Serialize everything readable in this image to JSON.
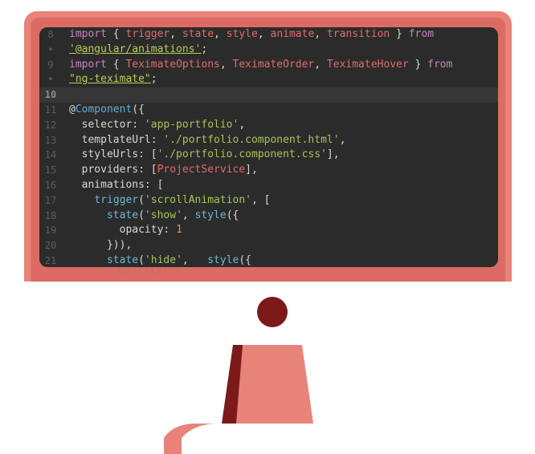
{
  "editor": {
    "lines": [
      {
        "num": "8",
        "tokens": [
          {
            "t": "import",
            "c": "kw"
          },
          {
            "t": " { ",
            "c": "plain"
          },
          {
            "t": "trigger",
            "c": "var"
          },
          {
            "t": ", ",
            "c": "plain"
          },
          {
            "t": "state",
            "c": "var"
          },
          {
            "t": ", ",
            "c": "plain"
          },
          {
            "t": "style",
            "c": "var"
          },
          {
            "t": ", ",
            "c": "plain"
          },
          {
            "t": "animate",
            "c": "var"
          },
          {
            "t": ", ",
            "c": "plain"
          },
          {
            "t": "transition",
            "c": "var"
          },
          {
            "t": " } ",
            "c": "plain"
          },
          {
            "t": "from",
            "c": "kw"
          }
        ]
      },
      {
        "num": "•",
        "tokens": [
          {
            "t": "'@angular/animations'",
            "c": "strul"
          },
          {
            "t": ";",
            "c": "plain"
          }
        ]
      },
      {
        "num": "9",
        "tokens": [
          {
            "t": "import",
            "c": "kw"
          },
          {
            "t": " { ",
            "c": "plain"
          },
          {
            "t": "TeximateOptions",
            "c": "var"
          },
          {
            "t": ", ",
            "c": "plain"
          },
          {
            "t": "TeximateOrder",
            "c": "var"
          },
          {
            "t": ", ",
            "c": "plain"
          },
          {
            "t": "TeximateHover",
            "c": "var"
          },
          {
            "t": " } ",
            "c": "plain"
          },
          {
            "t": "from",
            "c": "kw"
          }
        ]
      },
      {
        "num": "•",
        "tokens": [
          {
            "t": "\"ng-teximate\"",
            "c": "strul"
          },
          {
            "t": ";",
            "c": "plain"
          }
        ]
      },
      {
        "num": "10",
        "current": true,
        "tokens": []
      },
      {
        "num": "11",
        "tokens": [
          {
            "t": "@",
            "c": "plain"
          },
          {
            "t": "Component",
            "c": "dec"
          },
          {
            "t": "({",
            "c": "plain"
          }
        ]
      },
      {
        "num": "12",
        "tokens": [
          {
            "t": "  selector: ",
            "c": "plain"
          },
          {
            "t": "'app-portfolio'",
            "c": "str"
          },
          {
            "t": ",",
            "c": "plain"
          }
        ]
      },
      {
        "num": "13",
        "tokens": [
          {
            "t": "  templateUrl: ",
            "c": "plain"
          },
          {
            "t": "'./portfolio.component.html'",
            "c": "str"
          },
          {
            "t": ",",
            "c": "plain"
          }
        ]
      },
      {
        "num": "14",
        "tokens": [
          {
            "t": "  styleUrls: [",
            "c": "plain"
          },
          {
            "t": "'./portfolio.component.css'",
            "c": "str"
          },
          {
            "t": "],",
            "c": "plain"
          }
        ]
      },
      {
        "num": "15",
        "tokens": [
          {
            "t": "  providers: [",
            "c": "plain"
          },
          {
            "t": "ProjectService",
            "c": "var"
          },
          {
            "t": "],",
            "c": "plain"
          }
        ]
      },
      {
        "num": "16",
        "tokens": [
          {
            "t": "  animations: [",
            "c": "plain"
          }
        ]
      },
      {
        "num": "17",
        "tokens": [
          {
            "t": "    ",
            "c": "plain"
          },
          {
            "t": "trigger",
            "c": "call"
          },
          {
            "t": "(",
            "c": "plain"
          },
          {
            "t": "'scrollAnimation'",
            "c": "str"
          },
          {
            "t": ", [",
            "c": "plain"
          }
        ]
      },
      {
        "num": "18",
        "tokens": [
          {
            "t": "      ",
            "c": "plain"
          },
          {
            "t": "state",
            "c": "call"
          },
          {
            "t": "(",
            "c": "plain"
          },
          {
            "t": "'show'",
            "c": "str"
          },
          {
            "t": ", ",
            "c": "plain"
          },
          {
            "t": "style",
            "c": "call"
          },
          {
            "t": "({",
            "c": "plain"
          }
        ]
      },
      {
        "num": "19",
        "tokens": [
          {
            "t": "        opacity: ",
            "c": "plain"
          },
          {
            "t": "1",
            "c": "num"
          }
        ]
      },
      {
        "num": "20",
        "tokens": [
          {
            "t": "      })),",
            "c": "plain"
          }
        ]
      },
      {
        "num": "21",
        "tokens": [
          {
            "t": "      ",
            "c": "plain"
          },
          {
            "t": "state",
            "c": "call"
          },
          {
            "t": "(",
            "c": "plain"
          },
          {
            "t": "'hide'",
            "c": "str"
          },
          {
            "t": ",   ",
            "c": "plain"
          },
          {
            "t": "style",
            "c": "call"
          },
          {
            "t": "({",
            "c": "plain"
          }
        ]
      }
    ],
    "peek_line": "opacity: 0"
  },
  "colors": {
    "monitor": "#e8837a",
    "monitor_inner": "#dc6c63",
    "screen_bg": "#2a2b2a",
    "stand": "#e8837a",
    "stand_shadow": "#7b1a18",
    "knob": "#7b1a18"
  }
}
